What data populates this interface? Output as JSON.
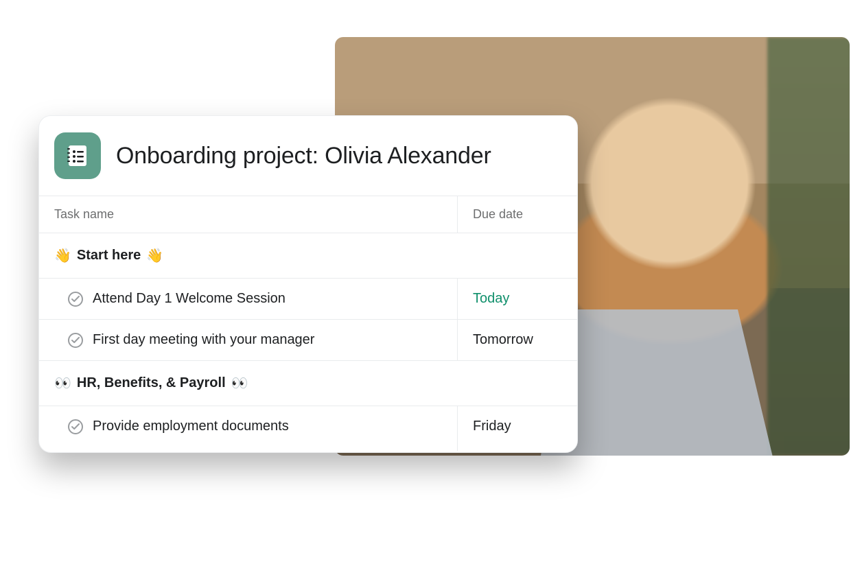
{
  "project": {
    "title": "Onboarding project: Olivia Alexander",
    "icon_name": "notebook-list-icon",
    "icon_bg": "#5f9f8b"
  },
  "columns": {
    "task_name": "Task name",
    "due_date": "Due date"
  },
  "sections": [
    {
      "emoji": "👋",
      "title": "Start here",
      "tasks": [
        {
          "name": "Attend Day 1 Welcome Session",
          "due": "Today",
          "due_accent": true
        },
        {
          "name": "First day meeting with your manager",
          "due": "Tomorrow",
          "due_accent": false
        }
      ]
    },
    {
      "emoji": "👀",
      "title": "HR, Benefits, & Payroll",
      "tasks": [
        {
          "name": "Provide employment documents",
          "due": "Friday",
          "due_accent": false
        }
      ]
    }
  ]
}
